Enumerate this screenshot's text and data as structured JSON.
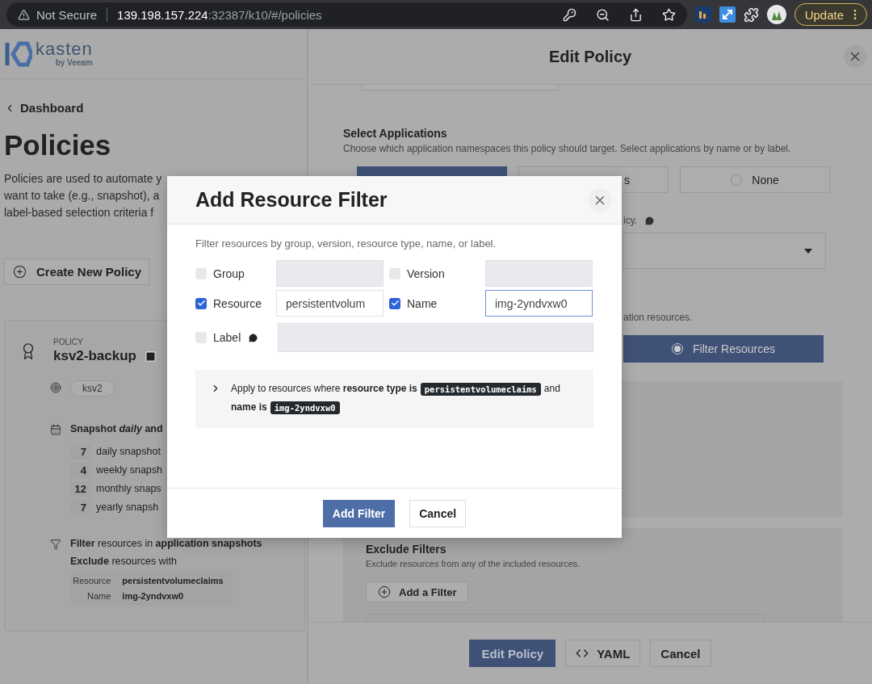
{
  "browser": {
    "security": "Not Secure",
    "url_host": "139.198.157.224",
    "url_path": ":32387/k10/#/policies",
    "update_button": "Update"
  },
  "brand": {
    "name": "kasten",
    "tagline": "by Veeam"
  },
  "page": {
    "back_link": "Dashboard",
    "title": "Policies",
    "description": [
      "Policies are used to automate y",
      "want to take (e.g., snapshot), a",
      "label-based selection criteria f"
    ],
    "create_button": "Create New Policy"
  },
  "policy_card": {
    "label": "POLICY",
    "name": "ksv2-backup",
    "tags": [
      "ksv2"
    ],
    "schedule": "Snapshot *daily* and",
    "retention": [
      {
        "count": "7",
        "label": "daily snapshot"
      },
      {
        "count": "4",
        "label": "weekly snapsh"
      },
      {
        "count": "12",
        "label": "monthly snaps"
      },
      {
        "count": "7",
        "label": "yearly snapsh"
      }
    ],
    "filter_summary": "**Filter** resources in **application snapshots**",
    "exclude_heading": "**Exclude** resources with",
    "exclude_rules": [
      {
        "field": "Resource",
        "value": "persistentvolumeclaims"
      },
      {
        "field": "Name",
        "value": "img-2yndvxw0"
      }
    ]
  },
  "drawer": {
    "title": "Edit Policy",
    "section_title": "Select Applications",
    "section_description": "Choose which application namespaces this policy should target. Select applications by name or by label.",
    "target_options": [
      {
        "selected": true
      },
      {
        "label": "s",
        "selected": false
      },
      {
        "label": "None",
        "selected": false
      }
    ],
    "hint_tail": "icy.",
    "filter_hint_tail": "ation resources.",
    "filter_mode_button": {
      "label": "Filter Resources",
      "selected": true
    },
    "exclude": {
      "title": "Exclude Filters",
      "description": "Exclude resources from any of the included resources.",
      "add_button": "Add a Filter"
    },
    "footer_buttons": [
      {
        "label": "Edit Policy",
        "kind": "primary"
      },
      {
        "label": "YAML",
        "kind": "code"
      },
      {
        "label": "Cancel",
        "kind": "plain"
      }
    ]
  },
  "modal": {
    "title": "Add Resource Filter",
    "description": "Filter resources by group, version, resource type, name, or label.",
    "fields": [
      {
        "label": "Group",
        "checked": false,
        "focused": false
      },
      {
        "label": "Version",
        "checked": false,
        "focused": false
      },
      {
        "label": "Resource",
        "checked": true,
        "value": "persistentvolum",
        "focused": false
      },
      {
        "label": "Name",
        "checked": true,
        "value": "img-2yndvxw0",
        "focused": true
      }
    ],
    "label_field": {
      "label": "Label",
      "checked": false
    },
    "summary": {
      "expanded": false,
      "lines": [
        [
          {
            "kind": "text",
            "text": "Apply to resources where **resource type is**"
          },
          {
            "kind": "code",
            "text": "persistentvolumeclaims"
          },
          {
            "kind": "text",
            "text": "and"
          }
        ],
        [
          {
            "kind": "text",
            "text": "**name is**"
          },
          {
            "kind": "code",
            "text": "img-2yndvxw0"
          }
        ]
      ]
    },
    "buttons": [
      {
        "label": "Add Filter",
        "kind": "primary"
      },
      {
        "label": "Cancel",
        "kind": "plain"
      }
    ]
  }
}
